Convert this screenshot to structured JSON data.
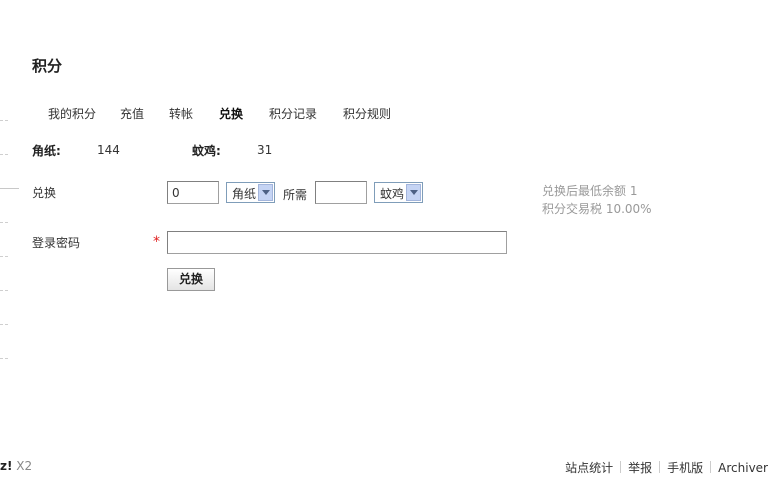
{
  "page": {
    "title": "积分"
  },
  "tabs": [
    {
      "label": "我的积分",
      "active": false
    },
    {
      "label": "充值",
      "active": false
    },
    {
      "label": "转帐",
      "active": false
    },
    {
      "label": "兑换",
      "active": true
    },
    {
      "label": "积分记录",
      "active": false
    },
    {
      "label": "积分规则",
      "active": false
    }
  ],
  "credits": [
    {
      "label": "角纸:",
      "value": "144"
    },
    {
      "label": "蚊鸡:",
      "value": "31"
    }
  ],
  "exchange": {
    "label": "兑换",
    "amount_value": "0",
    "from_unit": "角纸",
    "need_label": "所需",
    "need_value": "",
    "to_unit": "蚊鸡",
    "hint_min_balance": "兑换后最低余额 1",
    "hint_tax": "积分交易税 10.00%"
  },
  "password": {
    "label": "登录密码",
    "required_mark": "*",
    "value": ""
  },
  "submit": {
    "label": "兑换"
  },
  "footer": {
    "brand": "z!",
    "version": "X2",
    "links": [
      "站点统计",
      "举报",
      "手机版",
      "Archiver"
    ]
  }
}
